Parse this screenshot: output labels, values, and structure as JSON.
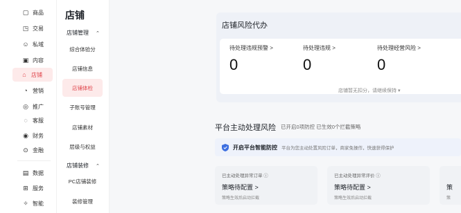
{
  "rail": {
    "items": [
      {
        "label": "商品",
        "icon": "goods-icon",
        "glyph": "▢"
      },
      {
        "label": "交易",
        "icon": "trade-icon",
        "glyph": "◳"
      },
      {
        "label": "私域",
        "icon": "private-domain-icon",
        "glyph": "☺"
      },
      {
        "label": "内容",
        "icon": "content-icon",
        "glyph": "▣"
      },
      {
        "label": "店铺",
        "icon": "store-icon",
        "glyph": "⌂"
      },
      {
        "label": "营销",
        "icon": "marketing-icon",
        "glyph": "◔"
      },
      {
        "label": "推广",
        "icon": "promotion-icon",
        "glyph": "◎"
      },
      {
        "label": "客服",
        "icon": "service-icon",
        "glyph": "◌"
      },
      {
        "label": "财务",
        "icon": "finance-icon",
        "glyph": "◉"
      },
      {
        "label": "金融",
        "icon": "credit-icon",
        "glyph": "⊙"
      },
      {
        "label": "数据",
        "icon": "data-icon",
        "glyph": "▤"
      },
      {
        "label": "服务",
        "icon": "service-market-icon",
        "glyph": "⊞"
      },
      {
        "label": "智能",
        "icon": "smart-icon",
        "glyph": "✧"
      }
    ],
    "active": "店铺"
  },
  "subnav": {
    "title": "店铺",
    "groups": [
      {
        "label": "店铺管理",
        "chevron": "⌃"
      },
      {
        "label": "店铺装修",
        "chevron": "⌃"
      }
    ],
    "items": [
      "综合体验分",
      "店铺信息",
      "店铺体检",
      "子账号管理",
      "店铺素材",
      "层级与权益",
      "PC店铺装修",
      "装修管理"
    ],
    "active": "店铺体检"
  },
  "risk": {
    "title": "店铺风险代办",
    "stats": [
      {
        "label": "待处理违规预警 >",
        "value": "0"
      },
      {
        "label": "待处理违规 >",
        "value": "0"
      },
      {
        "label": "待处理经营风险 >",
        "value": "0"
      }
    ],
    "note": "店铺暂无扣分，请继续保持 ▾"
  },
  "platform": {
    "title": "平台主动处理风险",
    "subtitle": "已开启0项防控 已生效0个拦截策略",
    "smart_label": "开启平台智能防控",
    "smart_desc": "平台为您主动处置风险订单，商家免操作，快速获得保护",
    "cards": [
      {
        "head": "已主动处理异常订单 ⓘ",
        "status": "策略待配置 >",
        "foot": "策略生效后启动拦截"
      },
      {
        "head": "已主动处理异常评价 ⓘ",
        "status": "策略待配置 >",
        "foot": "策略生效后启动拦截"
      },
      {
        "head": "",
        "status": "策",
        "foot": "策"
      }
    ]
  },
  "colors": {
    "accent": "#e0474d",
    "shield": "#3d6fe0"
  }
}
